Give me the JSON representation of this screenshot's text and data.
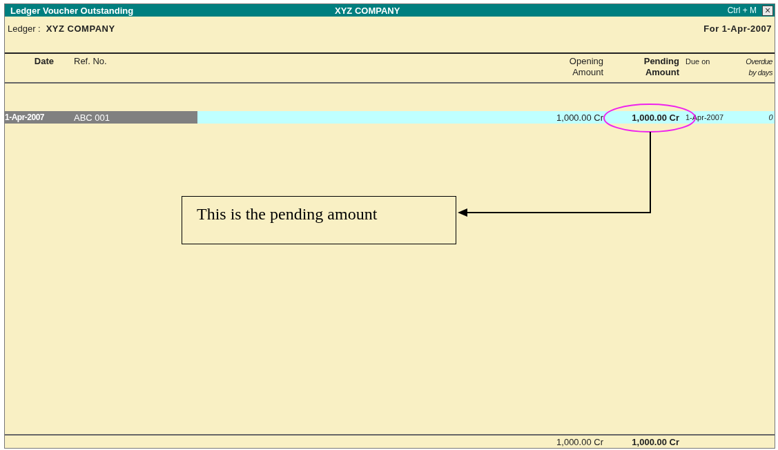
{
  "window": {
    "title": "Ledger Voucher Outstanding",
    "company": "XYZ COMPANY",
    "shortcut": "Ctrl + M",
    "close": "×"
  },
  "ledger": {
    "label": "Ledger :",
    "value": "XYZ COMPANY",
    "period": "For 1-Apr-2007"
  },
  "columns": [
    {
      "lines": [
        "Date"
      ]
    },
    {
      "lines": [
        "Ref. No."
      ]
    },
    {
      "lines": [
        "Opening",
        "Amount"
      ]
    },
    {
      "lines": [
        "Pending",
        "Amount"
      ]
    },
    {
      "lines": [
        "Due on"
      ]
    },
    {
      "lines": [
        "Overdue",
        "by days"
      ]
    }
  ],
  "rows": [
    {
      "selected": true,
      "date": "1-Apr-2007",
      "ref": "ABC 001",
      "opening": "1,000.00 Cr",
      "pending": "1,000.00 Cr",
      "due": "1-Apr-2007",
      "overdue": "0"
    }
  ],
  "totals": {
    "opening": "1,000.00 Cr",
    "pending": "1,000.00 Cr"
  },
  "callout": {
    "text": "This is the pending amount"
  }
}
